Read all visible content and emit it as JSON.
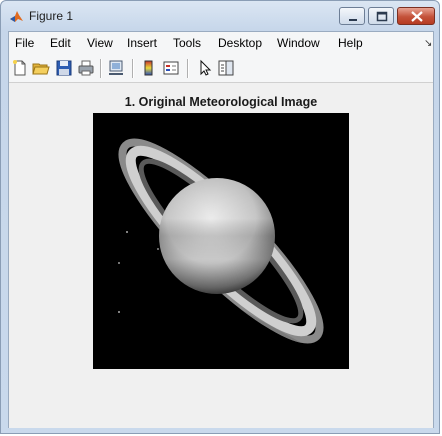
{
  "window": {
    "title": "Figure 1"
  },
  "menu": {
    "items": [
      {
        "label": "File"
      },
      {
        "label": "Edit"
      },
      {
        "label": "View"
      },
      {
        "label": "Insert"
      },
      {
        "label": "Tools"
      },
      {
        "label": "Desktop"
      },
      {
        "label": "Window"
      },
      {
        "label": "Help"
      }
    ]
  },
  "toolbar": {
    "buttons": [
      "new-figure-icon",
      "open-folder-icon",
      "save-icon",
      "print-icon",
      "link-figure-icon",
      "insert-colorbar-icon",
      "insert-legend-icon",
      "edit-plot-cursor-icon",
      "property-editor-icon"
    ]
  },
  "axes": {
    "title": "1. Original Meteorological Image"
  },
  "colors": {
    "close_button": "#c4523a",
    "matlab_orange": "#e06a20"
  }
}
